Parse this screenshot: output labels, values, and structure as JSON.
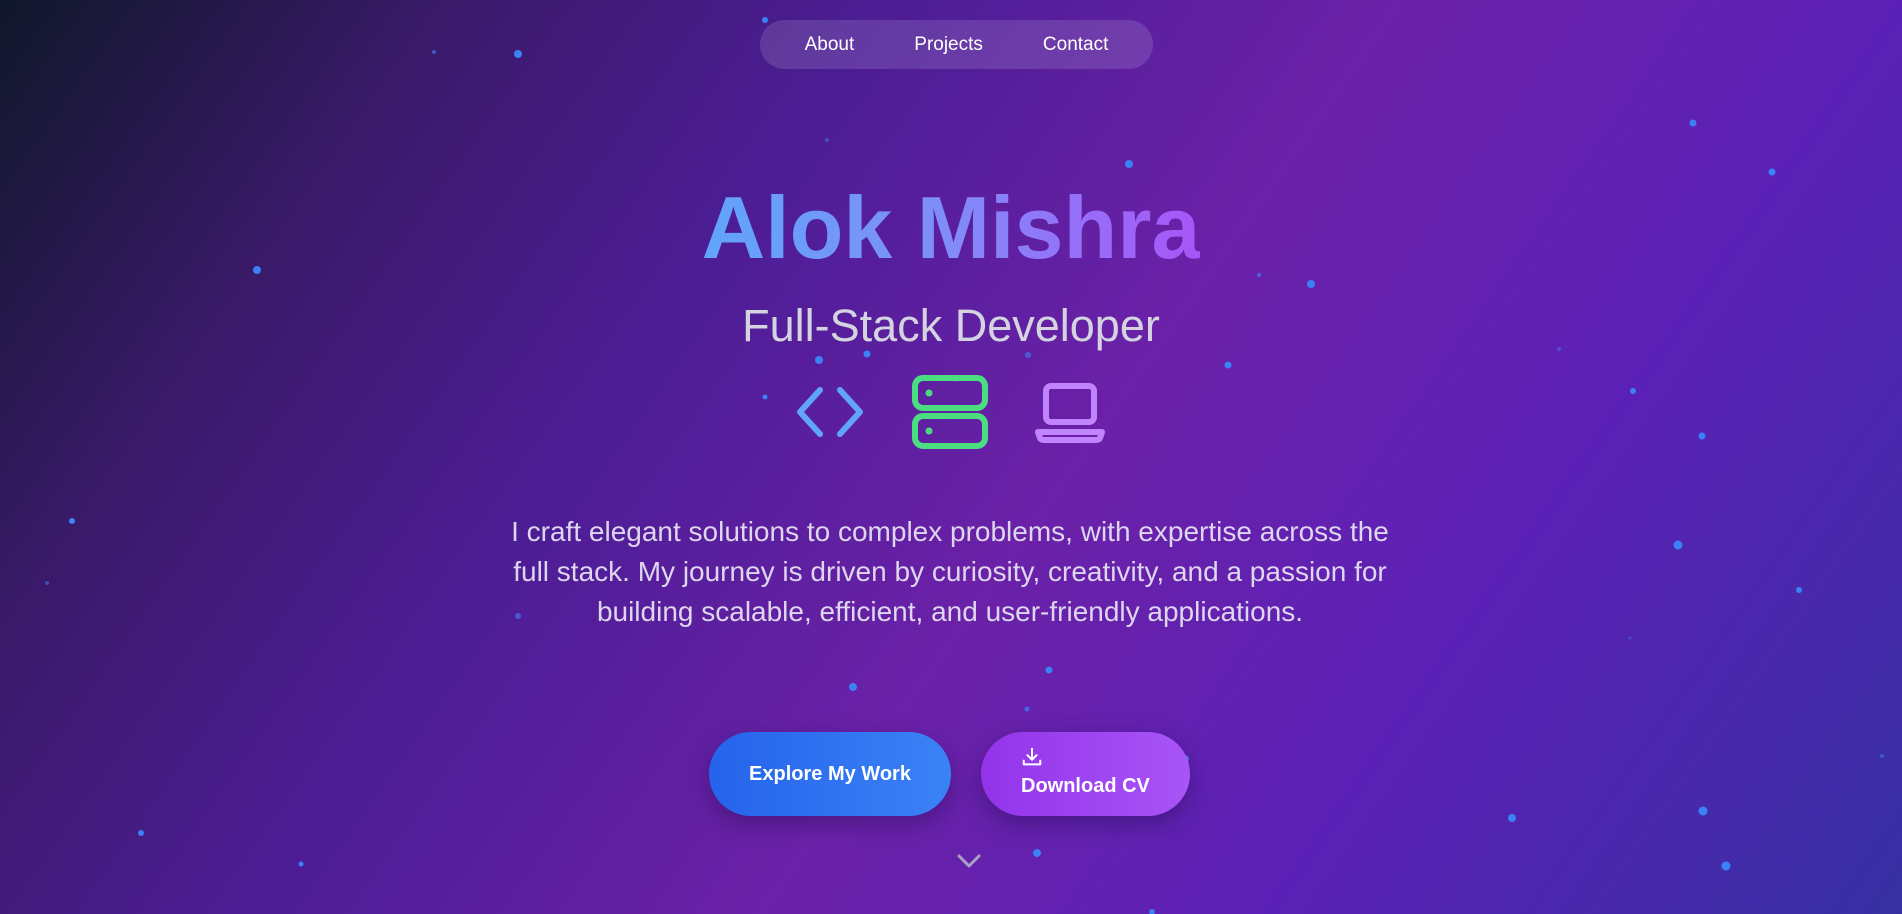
{
  "nav": {
    "items": [
      {
        "label": "About"
      },
      {
        "label": "Projects"
      },
      {
        "label": "Contact"
      }
    ]
  },
  "hero": {
    "name": "Alok Mishra",
    "role": "Full-Stack Developer",
    "icons": [
      "code-icon",
      "server-icon",
      "laptop-icon"
    ],
    "bio": "I craft elegant solutions to complex problems, with expertise across the full stack. My journey is driven by curiosity, creativity, and a passion for building scalable, efficient, and user-friendly applications."
  },
  "buttons": {
    "explore_label": "Explore My Work",
    "download_label": "Download CV"
  },
  "colors": {
    "accent_blue": "#3b82f6",
    "accent_green": "#4ade80",
    "accent_purple": "#a855f7",
    "background_mid": "#6b21a8"
  }
}
